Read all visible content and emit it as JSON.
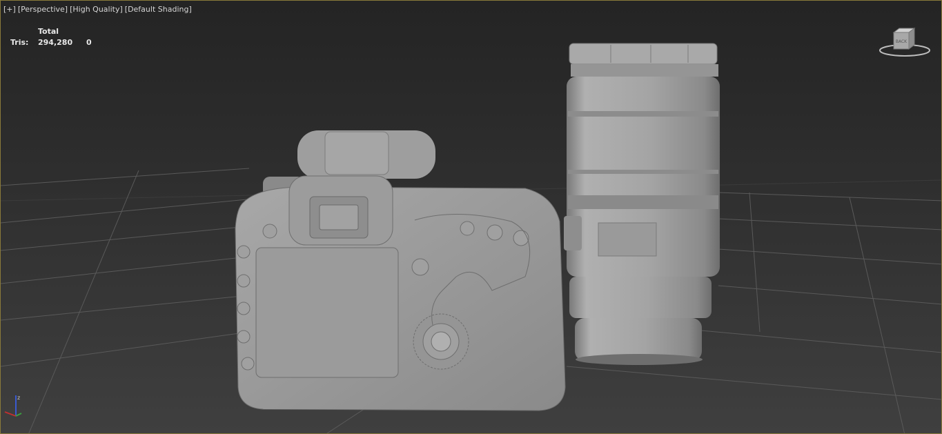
{
  "viewport": {
    "labels": [
      "[+]",
      "[Perspective]",
      "[High Quality]",
      "[Default Shading]"
    ],
    "stats": {
      "total_label": "Total",
      "tris_label": "Tris:",
      "tris_total": "294,280",
      "tris_selected": "0"
    },
    "viewcube": {
      "face_label": "BACK",
      "icon": "viewcube-icon"
    },
    "axis_tripod": {
      "z_label": "z",
      "icon": "axis-tripod-icon"
    }
  },
  "colors": {
    "border": "#8a7a3a",
    "grid": "#5a5a5a",
    "model": "#9c9c9c"
  }
}
